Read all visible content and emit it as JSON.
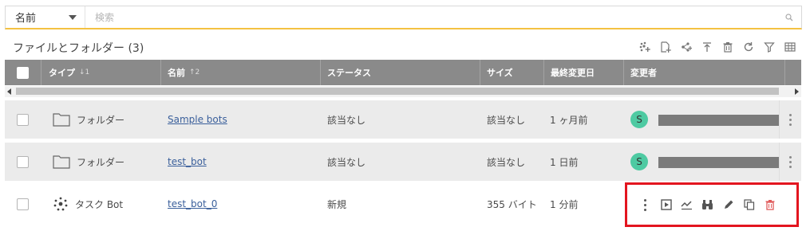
{
  "search": {
    "field_label": "名前",
    "placeholder": "検索"
  },
  "panel": {
    "title": "ファイルとフォルダー (3)"
  },
  "toolbar": {
    "icons": [
      "create-bot-icon",
      "new-file-icon",
      "share-icon",
      "upload-icon",
      "delete-icon",
      "refresh-icon",
      "filter-icon",
      "grid-view-icon"
    ]
  },
  "table": {
    "columns": [
      {
        "label": "タイプ",
        "sort": "↓1"
      },
      {
        "label": "名前",
        "sort": "↑2"
      },
      {
        "label": "ステータス"
      },
      {
        "label": "サイズ"
      },
      {
        "label": "最終変更日"
      },
      {
        "label": "変更者"
      }
    ],
    "rows": [
      {
        "type_icon": "folder-icon",
        "type": "フォルダー",
        "name": "Sample bots",
        "status": "該当なし",
        "size": "該当なし",
        "modified": "1 ヶ月前",
        "modified_by_initial": "S"
      },
      {
        "type_icon": "folder-icon",
        "type": "フォルダー",
        "name": "test_bot",
        "status": "該当なし",
        "size": "該当なし",
        "modified": "1 日前",
        "modified_by_initial": "S"
      },
      {
        "type_icon": "task-bot-icon",
        "type": "タスク Bot",
        "name": "test_bot_0",
        "status": "新規",
        "size": "355 バイト",
        "modified": "1 分前"
      }
    ]
  },
  "row_actions": [
    "more-icon",
    "run-icon",
    "analytics-icon",
    "view-icon",
    "edit-icon",
    "copy-icon",
    "delete-icon"
  ],
  "colors": {
    "accent_underline": "#f4c242",
    "header_bg": "#8a8a8a",
    "avatar": "#4ecaa2",
    "highlight_border": "#e3151f",
    "delete": "#e05a5a",
    "link": "#3a5f9b"
  }
}
